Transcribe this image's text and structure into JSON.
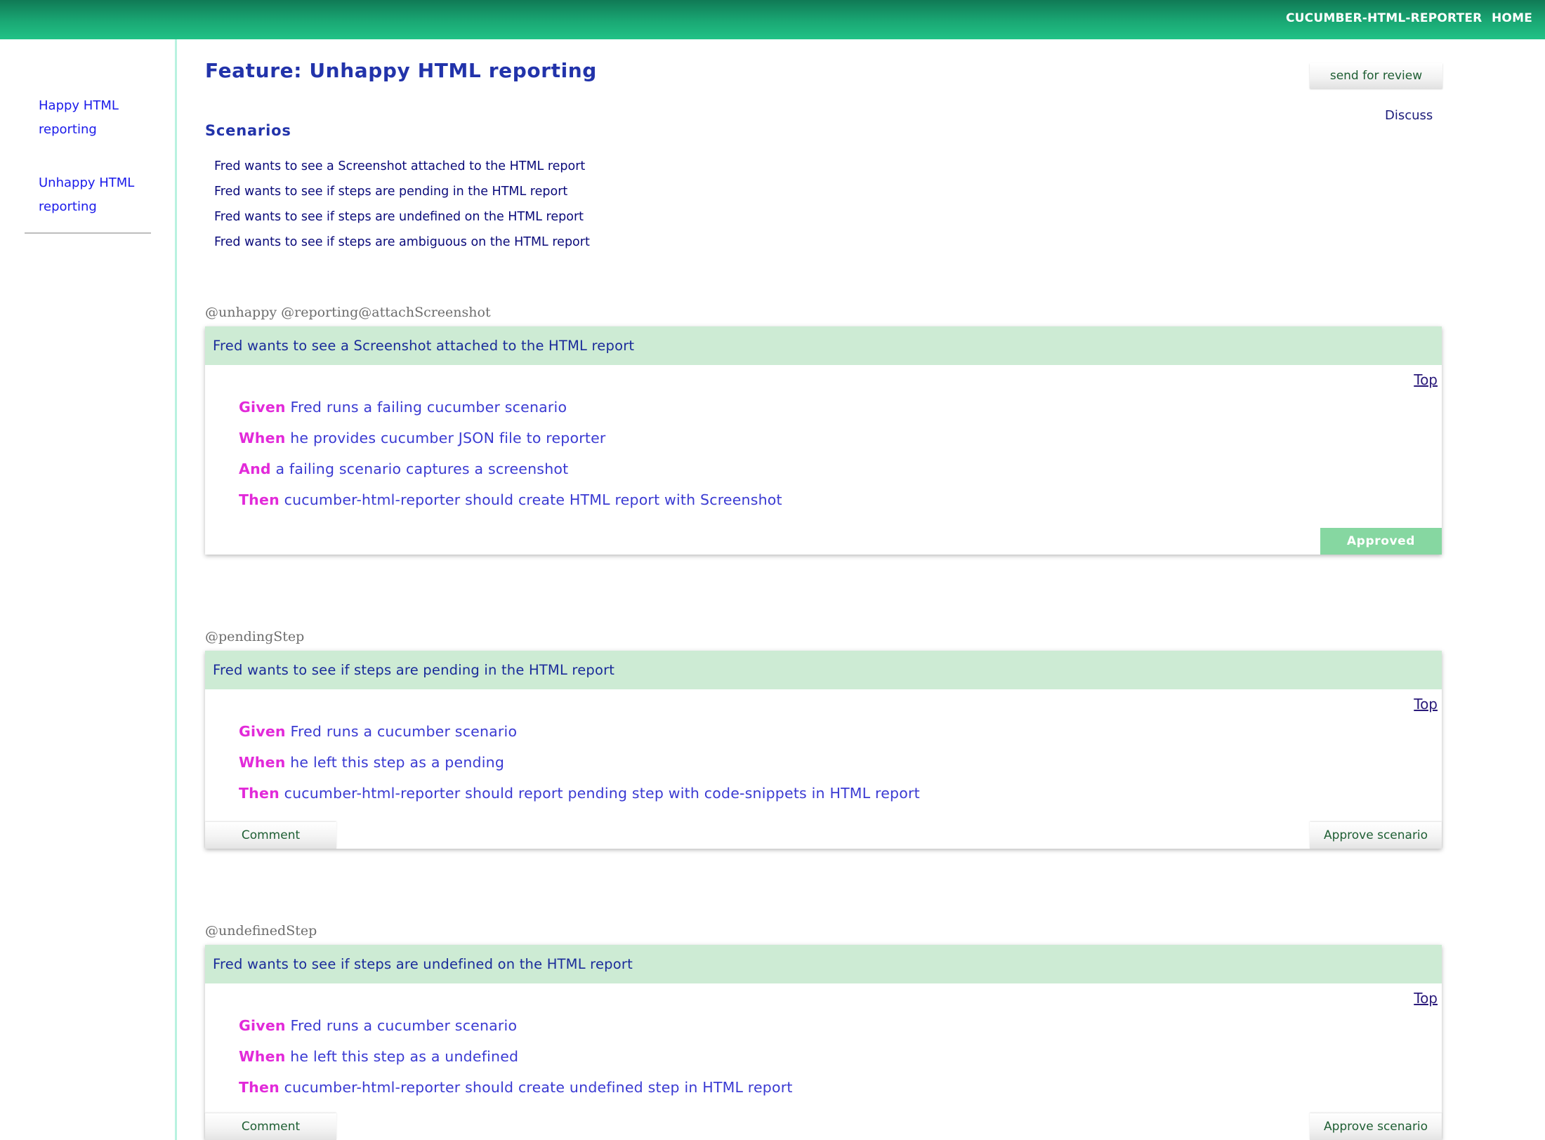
{
  "topbar": {
    "reporter_link": "CUCUMBER-HTML-REPORTER",
    "home_link": "HOME"
  },
  "sidebar": {
    "items": [
      {
        "label": "Happy HTML reporting"
      },
      {
        "label": "Unhappy HTML reporting"
      }
    ]
  },
  "feature": {
    "title": "Feature: Unhappy HTML reporting",
    "send_review_label": "send for review",
    "discuss_label": "Discuss",
    "scenarios_heading": "Scenarios",
    "scenario_links": [
      "Fred wants to see a Screenshot attached to the HTML report",
      "Fred wants to see if steps are pending in the HTML report",
      "Fred wants to see if steps are undefined on the HTML report",
      "Fred wants to see if steps are ambiguous on the HTML report"
    ]
  },
  "scenarios": [
    {
      "tags": "@unhappy @reporting@attachScreenshot",
      "title": "Fred wants to see a Screenshot attached to the HTML report",
      "top_label": "Top",
      "steps": [
        {
          "keyword": "Given",
          "text": "Fred runs a failing cucumber scenario"
        },
        {
          "keyword": "When",
          "text": "he provides cucumber JSON file to reporter"
        },
        {
          "keyword": "And",
          "text": "a failing scenario captures a screenshot"
        },
        {
          "keyword": "Then",
          "text": "cucumber-html-reporter should create HTML report with Screenshot"
        }
      ],
      "status_label": "Approved"
    },
    {
      "tags": "@pendingStep",
      "title": "Fred wants to see if steps are pending in the HTML report",
      "top_label": "Top",
      "steps": [
        {
          "keyword": "Given",
          "text": "Fred runs a cucumber scenario"
        },
        {
          "keyword": "When",
          "text": "he left this step as a pending"
        },
        {
          "keyword": "Then",
          "text": "cucumber-html-reporter should report pending step with code-snippets in HTML report"
        }
      ],
      "comment_label": "Comment",
      "approve_label": "Approve scenario"
    },
    {
      "tags": "@undefinedStep",
      "title": "Fred wants to see if steps are undefined on the HTML report",
      "top_label": "Top",
      "steps": [
        {
          "keyword": "Given",
          "text": "Fred runs a cucumber scenario"
        },
        {
          "keyword": "When",
          "text": "he left this step as a undefined"
        },
        {
          "keyword": "Then",
          "text": "cucumber-html-reporter should create undefined step in HTML report"
        }
      ],
      "comment_label": "Comment",
      "approve_label": "Approve scenario"
    }
  ],
  "colors": {
    "topbar_start": "#107a55",
    "topbar_end": "#22c286",
    "scenario_header_bg": "#cdebd4",
    "keyword": "#e22ad9",
    "step_text": "#3a3ad2",
    "approved_badge": "#86d7a1",
    "title_blue": "#2233aa"
  }
}
